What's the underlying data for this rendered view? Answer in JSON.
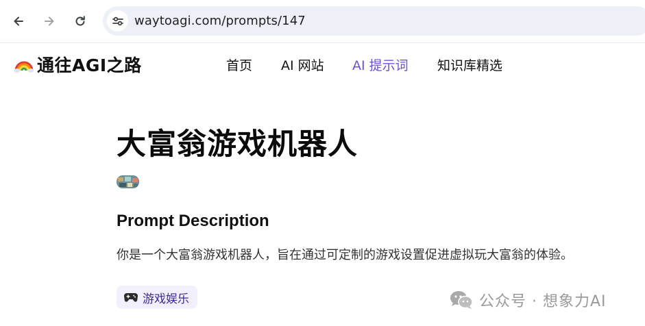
{
  "browser": {
    "url": "waytoagi.com/prompts/147",
    "icons": [
      "back-arrow-icon",
      "forward-arrow-icon",
      "reload-icon",
      "site-settings-icon"
    ]
  },
  "header": {
    "logo_text": "通往AGI之路",
    "logo_icon": "rainbow-icon",
    "nav": [
      {
        "label": "首页",
        "active": false
      },
      {
        "label": "AI 网站",
        "active": false
      },
      {
        "label": "AI 提示词",
        "active": true
      },
      {
        "label": "知识库精选",
        "active": false
      }
    ]
  },
  "article": {
    "title": "大富翁游戏机器人",
    "section_heading": "Prompt Description",
    "description": "你是一个大富翁游戏机器人，旨在通过可定制的游戏设置促进虚拟玩大富翁的体验。",
    "tag": {
      "icon": "game-controller-icon",
      "label": "游戏娱乐"
    }
  },
  "watermark": {
    "icon": "wechat-icon",
    "text": "公众号 · 想象力AI"
  },
  "colors": {
    "accent": "#6a4fe0",
    "tag_bg": "#f2efff",
    "omnibox_bg": "#edf0f7"
  }
}
